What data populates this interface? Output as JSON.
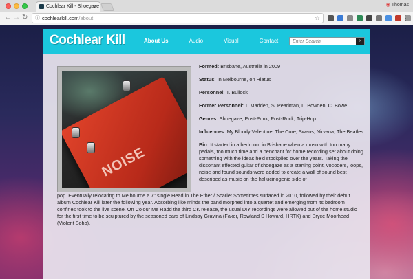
{
  "browser": {
    "tab_title": "Cochlear Kill - Shoegaze",
    "tab_close": "×",
    "url_host": "cochlearkill.com",
    "url_path": "/about",
    "profile_name": "Thomas"
  },
  "site": {
    "logo": "Cochlear Kill",
    "nav": [
      {
        "label": "About Us"
      },
      {
        "label": "Audio"
      },
      {
        "label": "Visual"
      },
      {
        "label": "Contact"
      }
    ],
    "search_placeholder": "Enter Search",
    "search_button": "›"
  },
  "photo": {
    "pedal_label": "NOISE"
  },
  "info": {
    "formed_label": "Formed:",
    "formed_value": "Brisbane, Australia in 2009",
    "status_label": "Status:",
    "status_value": "In Melbourne, on Hiatus",
    "personnel_label": "Personnel:",
    "personnel_value": "T. Bullock",
    "former_label": "Former Personnel:",
    "former_value": "T. Madden, S. Pearlman, L. Bowden, C. Bowe",
    "genres_label": "Genres:",
    "genres_value": "Shoegaze, Post-Punk, Post-Rock, Trip-Hop",
    "influences_label": "Influences:",
    "influences_value": "My Bloody Valentine, The Cure, Swans, Nirvana, The Beatles",
    "bio_label": "Bio:",
    "bio_value": "It started in a bedroom in Brisbane when a muso with too many pedals, too much time and a penchant for home recording set about doing something with the ideas he'd stockpiled over the years. Taking the dissonant effected guitar of shoegaze as a starting point, vocoders, loops, noise and found sounds were added to create a wall of sound best described as music on the hallucinogenic side of",
    "bio_continued": "pop. Eventually relocating to Melbourne a 7\" single Head in The Ether / Scarlet Sometimes surfaced in 2010, followed by their debut album Cochlear Kill later the following year. Absorbing like minds the band morphed into a quartet and emerging from its bedroom confines took to the live scene. On Colour Me Radd the third CK release, the usual DIY recordings were allowed out of the home studio for the first time to be sculptured by the seasoned ears of Lindsay Gravina (Faker, Rowland S Howard, HRTK) and Bryce Moorhead (Violent Soho)."
  }
}
